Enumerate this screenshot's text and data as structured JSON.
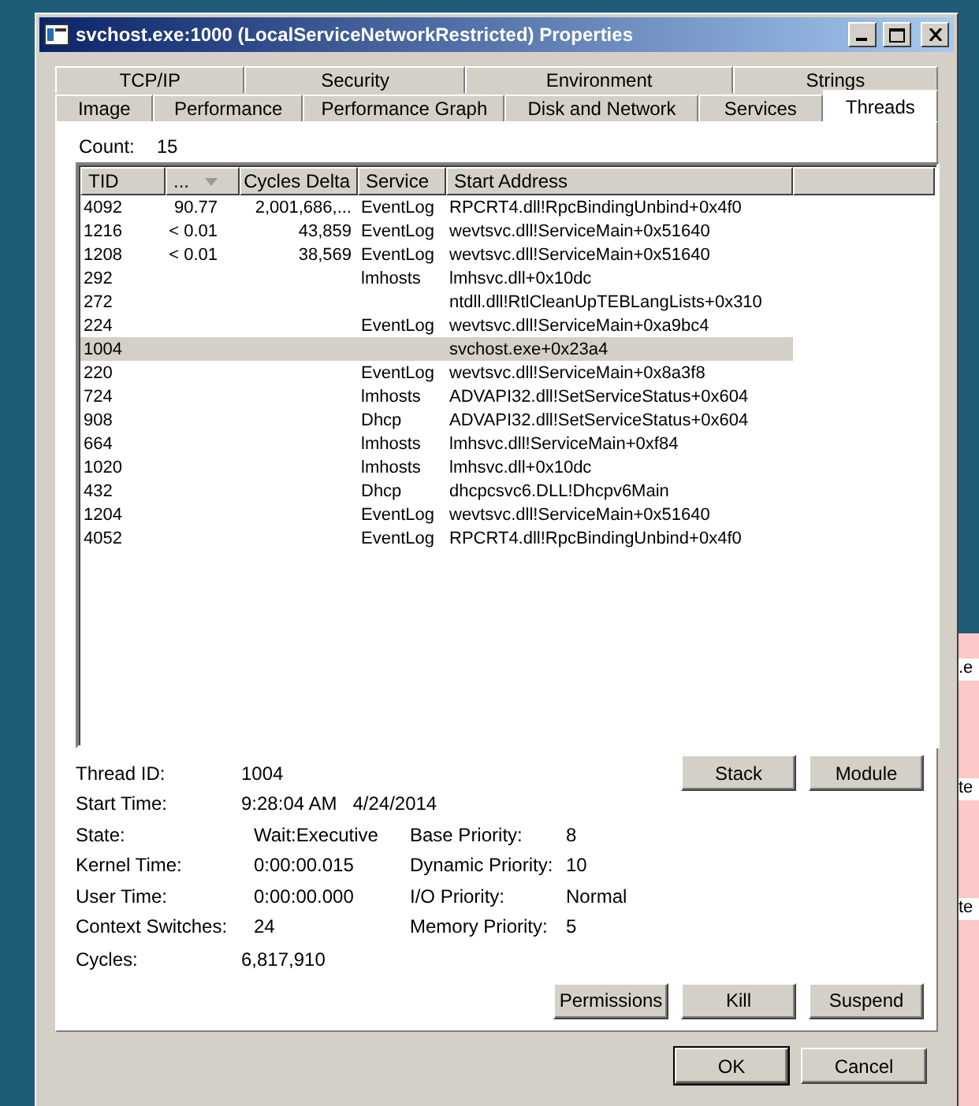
{
  "window": {
    "title": "svchost.exe:1000 (LocalServiceNetworkRestricted) Properties"
  },
  "tab_rows": [
    [
      {
        "label": "TCP/IP",
        "selected": false
      },
      {
        "label": "Security",
        "selected": false
      },
      {
        "label": "Environment",
        "selected": false
      },
      {
        "label": "Strings",
        "selected": false
      }
    ],
    [
      {
        "label": "Image",
        "selected": false
      },
      {
        "label": "Performance",
        "selected": false
      },
      {
        "label": "Performance Graph",
        "selected": false
      },
      {
        "label": "Disk and Network",
        "selected": false
      },
      {
        "label": "Services",
        "selected": false
      },
      {
        "label": "Threads",
        "selected": true
      }
    ]
  ],
  "count": {
    "label": "Count:",
    "value": "15"
  },
  "table": {
    "columns": [
      "TID",
      "...",
      "Cycles Delta",
      "Service",
      "Start Address"
    ],
    "rows": [
      {
        "cells": [
          "4092",
          "90.77",
          "2,001,686,...",
          "EventLog",
          "RPCRT4.dll!RpcBindingUnbind+0x4f0"
        ],
        "selected": false
      },
      {
        "cells": [
          "1216",
          "< 0.01",
          "43,859",
          "EventLog",
          "wevtsvc.dll!ServiceMain+0x51640"
        ],
        "selected": false
      },
      {
        "cells": [
          "1208",
          "< 0.01",
          "38,569",
          "EventLog",
          "wevtsvc.dll!ServiceMain+0x51640"
        ],
        "selected": false
      },
      {
        "cells": [
          "292",
          "",
          "",
          "lmhosts",
          "lmhsvc.dll+0x10dc"
        ],
        "selected": false
      },
      {
        "cells": [
          "272",
          "",
          "",
          "",
          "ntdll.dll!RtlCleanUpTEBLangLists+0x310"
        ],
        "selected": false
      },
      {
        "cells": [
          "224",
          "",
          "",
          "EventLog",
          "wevtsvc.dll!ServiceMain+0xa9bc4"
        ],
        "selected": false
      },
      {
        "cells": [
          "1004",
          "",
          "",
          "",
          "svchost.exe+0x23a4"
        ],
        "selected": true
      },
      {
        "cells": [
          "220",
          "",
          "",
          "EventLog",
          "wevtsvc.dll!ServiceMain+0x8a3f8"
        ],
        "selected": false
      },
      {
        "cells": [
          "724",
          "",
          "",
          "lmhosts",
          "ADVAPI32.dll!SetServiceStatus+0x604"
        ],
        "selected": false
      },
      {
        "cells": [
          "908",
          "",
          "",
          "Dhcp",
          "ADVAPI32.dll!SetServiceStatus+0x604"
        ],
        "selected": false
      },
      {
        "cells": [
          "664",
          "",
          "",
          "lmhosts",
          "lmhsvc.dll!ServiceMain+0xf84"
        ],
        "selected": false
      },
      {
        "cells": [
          "1020",
          "",
          "",
          "lmhosts",
          "lmhsvc.dll+0x10dc"
        ],
        "selected": false
      },
      {
        "cells": [
          "432",
          "",
          "",
          "Dhcp",
          "dhcpcsvc6.DLL!Dhcpv6Main"
        ],
        "selected": false
      },
      {
        "cells": [
          "1204",
          "",
          "",
          "EventLog",
          "wevtsvc.dll!ServiceMain+0x51640"
        ],
        "selected": false
      },
      {
        "cells": [
          "4052",
          "",
          "",
          "EventLog",
          "RPCRT4.dll!RpcBindingUnbind+0x4f0"
        ],
        "selected": false
      }
    ]
  },
  "details_left": [
    {
      "label": "Thread ID:",
      "value": "1004"
    },
    {
      "label": "Start Time:",
      "value": "9:28:04 AM   4/24/2014"
    }
  ],
  "details_grid": [
    {
      "label": "State:",
      "value": "Wait:Executive",
      "label_2": "Base Priority:",
      "value_2": "8"
    },
    {
      "label": "Kernel Time:",
      "value": "0:00:00.015",
      "label_2": "Dynamic Priority:",
      "value_2": "10"
    },
    {
      "label": "User Time:",
      "value": "0:00:00.000",
      "label_2": "I/O Priority:",
      "value_2": "Normal"
    },
    {
      "label": "Context Switches:",
      "value": "24",
      "label_2": "Memory Priority:",
      "value_2": "5"
    }
  ],
  "cycles": {
    "label": "Cycles:",
    "value": "6,817,910"
  },
  "thread_buttons": [
    "Stack",
    "Module"
  ],
  "action_buttons": [
    "Permissions",
    "Kill",
    "Suspend"
  ],
  "dialog_buttons": [
    {
      "label": "OK",
      "default": true
    },
    {
      "label": "Cancel",
      "default": false
    }
  ],
  "background_texts": [
    ".e",
    "te",
    "te"
  ]
}
